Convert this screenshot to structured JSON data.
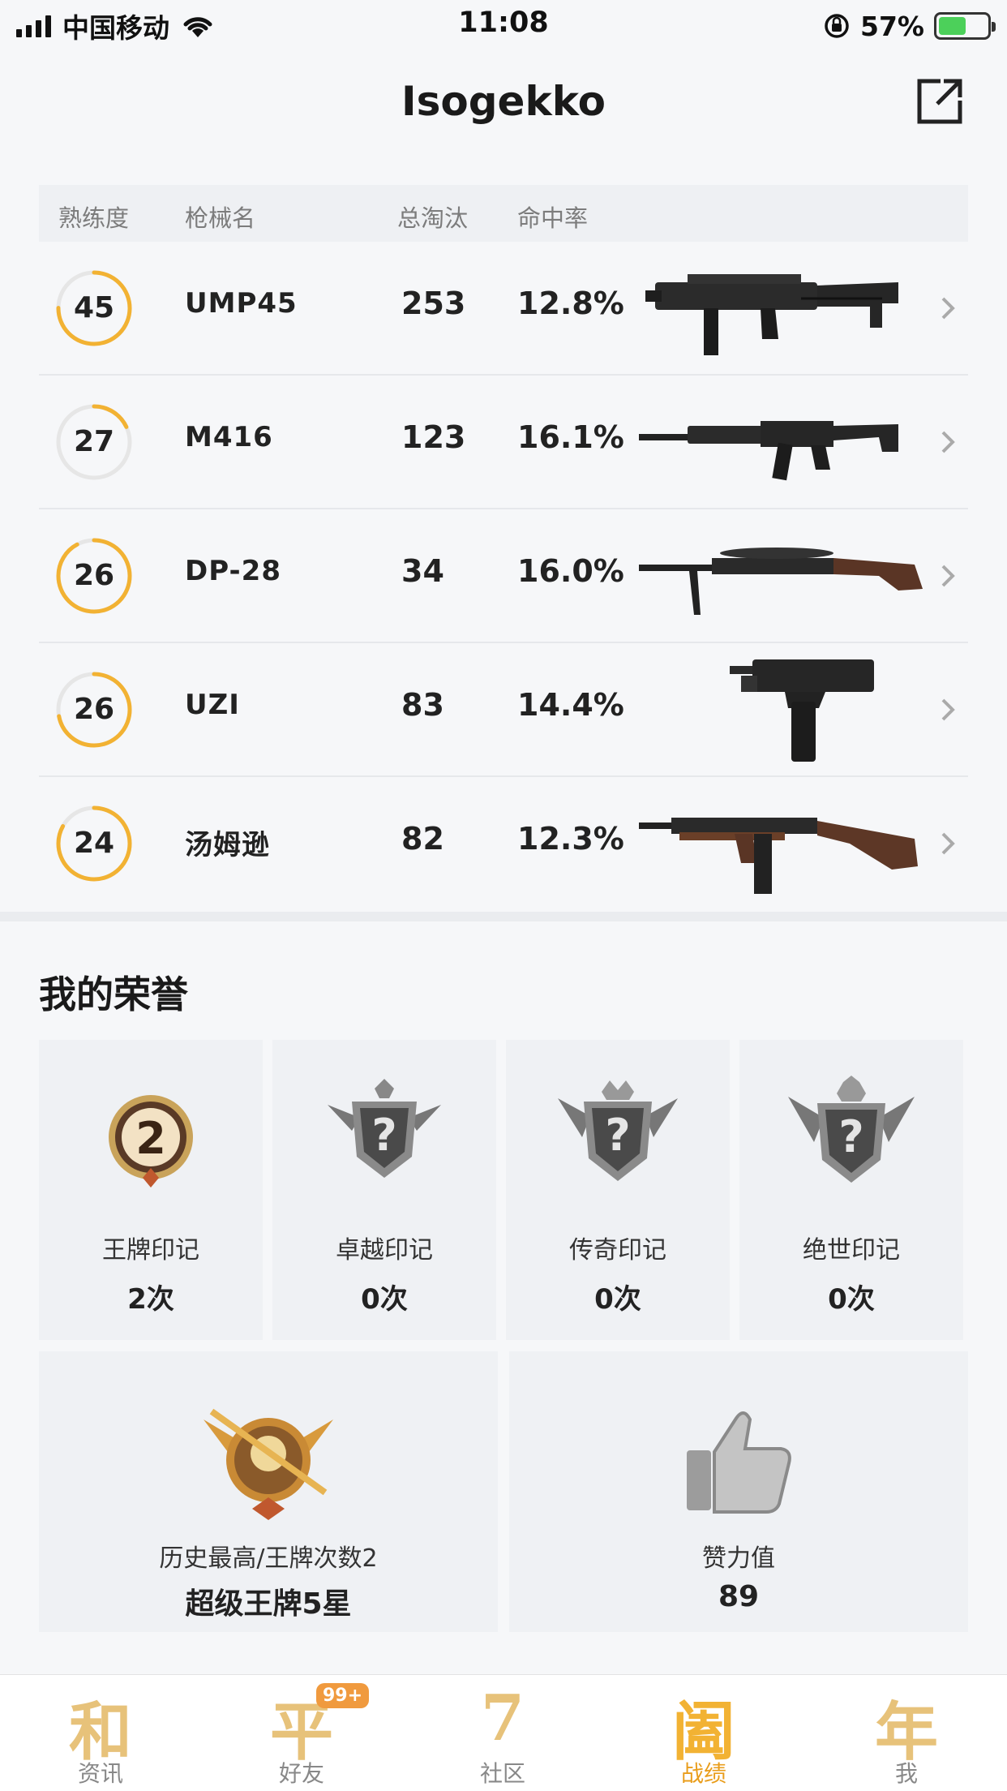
{
  "status_bar": {
    "carrier": "中国移动",
    "time": "11:08",
    "battery": "57%",
    "battery_level": 0.57
  },
  "header": {
    "title": "Isogekko",
    "share_icon": "share-external-icon"
  },
  "weapon_table": {
    "columns": [
      "熟练度",
      "枪械名",
      "总淘汰",
      "命中率"
    ],
    "rows": [
      {
        "mastery": "45",
        "mastery_progress": 0.75,
        "name": "UMP45",
        "kills": "253",
        "accuracy": "12.8%",
        "image": "ump45-gun-icon"
      },
      {
        "mastery": "27",
        "mastery_progress": 0.18,
        "name": "M416",
        "kills": "123",
        "accuracy": "16.1%",
        "image": "m416-gun-icon"
      },
      {
        "mastery": "26",
        "mastery_progress": 0.92,
        "name": "DP-28",
        "kills": "34",
        "accuracy": "16.0%",
        "image": "dp28-gun-icon"
      },
      {
        "mastery": "26",
        "mastery_progress": 0.72,
        "name": "UZI",
        "kills": "83",
        "accuracy": "14.4%",
        "image": "uzi-gun-icon"
      },
      {
        "mastery": "24",
        "mastery_progress": 0.83,
        "name": "汤姆逊",
        "kills": "82",
        "accuracy": "12.3%",
        "image": "thompson-gun-icon"
      }
    ]
  },
  "honors": {
    "title": "我的荣誉",
    "badges": [
      {
        "label": "王牌印记",
        "count": "2次",
        "icon": "ace-mark-icon"
      },
      {
        "label": "卓越印记",
        "count": "0次",
        "icon": "excellence-mark-icon"
      },
      {
        "label": "传奇印记",
        "count": "0次",
        "icon": "legend-mark-icon"
      },
      {
        "label": "绝世印记",
        "count": "0次",
        "icon": "peerless-mark-icon"
      }
    ],
    "highest": {
      "label": "历史最高/王牌次数2",
      "value": "超级王牌5星",
      "icon": "super-ace-tier-icon"
    },
    "likes": {
      "label": "赞力值",
      "value": "89",
      "icon": "thumbs-up-icon"
    }
  },
  "tabbar": {
    "tabs": [
      {
        "glyph": "和",
        "label": "资讯"
      },
      {
        "glyph": "平",
        "label": "好友",
        "badge": "99+"
      },
      {
        "glyph": "7",
        "label": "社区"
      },
      {
        "glyph": "阖",
        "label": "战绩"
      },
      {
        "glyph": "年",
        "label": "我"
      }
    ],
    "active_index": 3
  },
  "colors": {
    "accent_gold": "#f2b233",
    "ring_track": "#e6e6e6"
  }
}
